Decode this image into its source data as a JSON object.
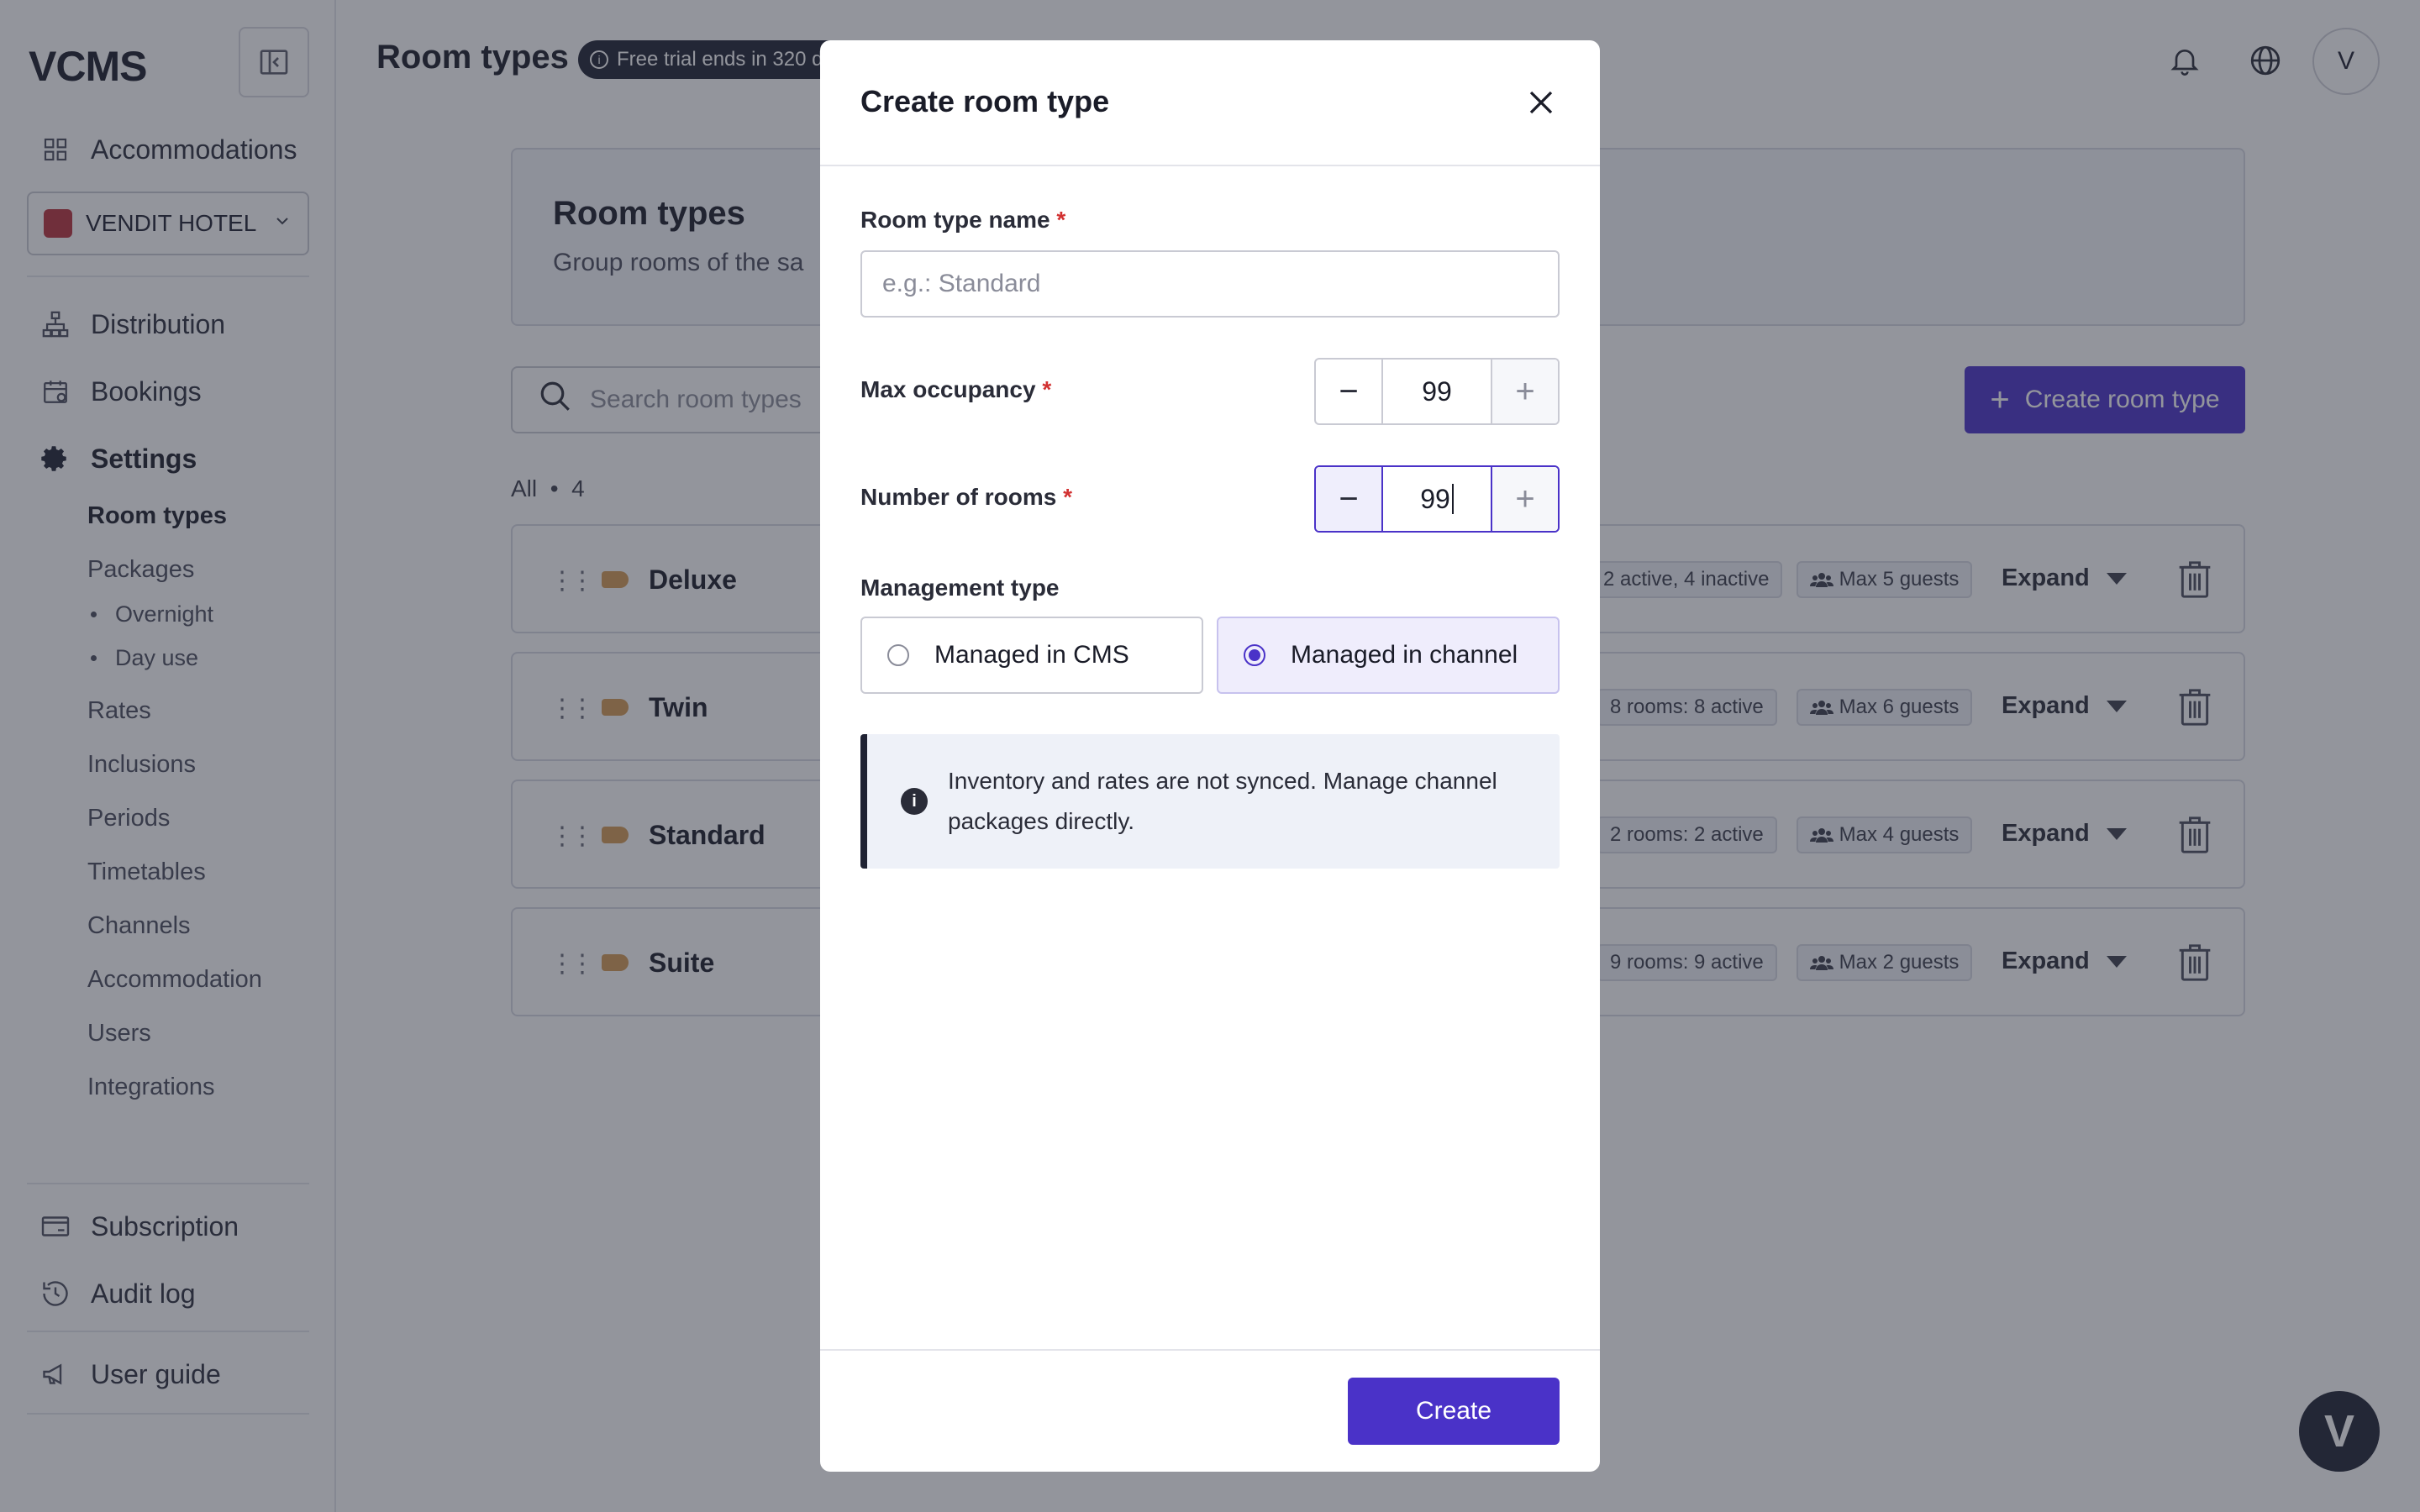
{
  "app": {
    "logo": "VCMS",
    "page_title": "Room types",
    "trial_notice": "Free trial ends in 320 d",
    "avatar_initial": "V",
    "chat_initial": "V"
  },
  "sidebar": {
    "accommodations": "Accommodations",
    "hotel": "VENDIT HOTEL",
    "distribution": "Distribution",
    "bookings": "Bookings",
    "settings": "Settings",
    "settings_items": [
      {
        "label": "Room types"
      },
      {
        "label": "Packages"
      },
      {
        "label": "Overnight"
      },
      {
        "label": "Day use"
      },
      {
        "label": "Rates"
      },
      {
        "label": "Inclusions"
      },
      {
        "label": "Periods"
      },
      {
        "label": "Timetables"
      },
      {
        "label": "Channels"
      },
      {
        "label": "Accommodation"
      },
      {
        "label": "Users"
      },
      {
        "label": "Integrations"
      }
    ],
    "subscription": "Subscription",
    "audit_log": "Audit log",
    "user_guide": "User guide"
  },
  "main": {
    "hero_title": "Room types",
    "hero_subtitle": "Group rooms of the sa",
    "search_placeholder": "Search room types",
    "create_button": "Create room type",
    "count_label": "All",
    "count_sep": "•",
    "count_value": "4",
    "expand_label": "Expand",
    "rooms": [
      {
        "name": "Deluxe",
        "status": "2 active, 4 inactive",
        "guests": "Max 5 guests"
      },
      {
        "name": "Twin",
        "status": "8 rooms: 8 active",
        "guests": "Max 6 guests"
      },
      {
        "name": "Standard",
        "status": "2 rooms: 2 active",
        "guests": "Max 4 guests"
      },
      {
        "name": "Suite",
        "status": "9 rooms: 9 active",
        "guests": "Max 2 guests"
      }
    ]
  },
  "modal": {
    "title": "Create room type",
    "name_label": "Room type name",
    "required_mark": "*",
    "name_placeholder": "e.g.: Standard",
    "max_occupancy_label": "Max occupancy",
    "max_occupancy_value": "99",
    "rooms_label": "Number of rooms",
    "rooms_value": "99",
    "management_label": "Management type",
    "option_cms": "Managed in CMS",
    "option_channel": "Managed in channel",
    "info_text": "Inventory and rates are not synced. Manage channel packages directly.",
    "submit": "Create"
  },
  "colors": {
    "accent": "#4a32c8",
    "dark": "#1f2233",
    "overlay": "rgba(40,44,58,0.5)"
  },
  "icons": [
    "sidebar-toggle-icon",
    "grid-icon",
    "hotel-icon",
    "chevron-down-icon",
    "distribution-icon",
    "calendar-icon",
    "gear-icon",
    "bell-icon",
    "globe-icon",
    "search-icon",
    "plus-icon",
    "drag-handle-icon",
    "tag-icon",
    "users-icon",
    "trash-icon",
    "close-icon",
    "info-icon",
    "card-icon",
    "history-icon",
    "megaphone-icon"
  ]
}
